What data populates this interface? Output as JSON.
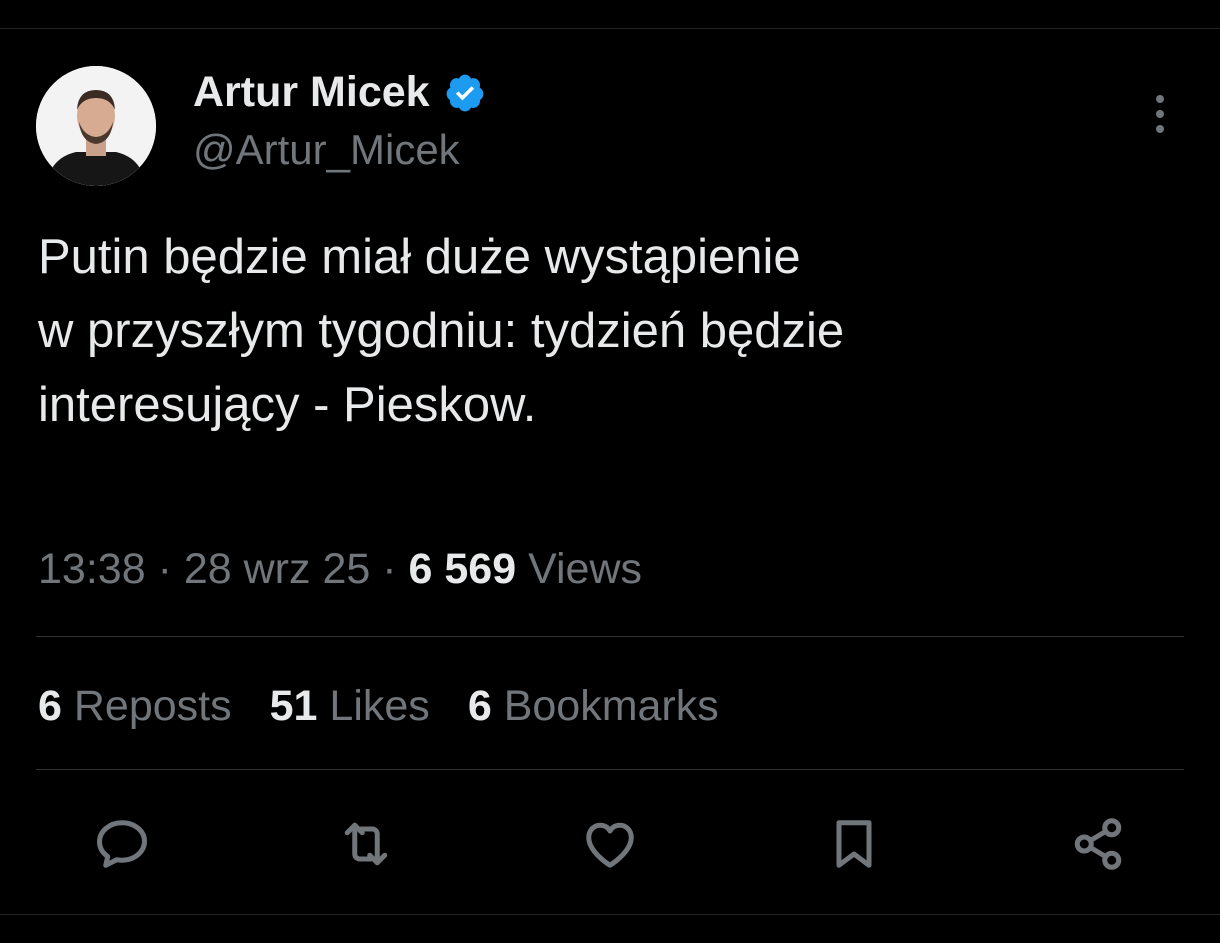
{
  "tweet": {
    "author": {
      "name": "Artur Micek",
      "handle": "@Artur_Micek",
      "verified": true,
      "verified_color": "#1d9bf0",
      "avatar_icon": "profile-photo"
    },
    "more_icon": "more-vertical-icon",
    "text_lines": [
      "Putin będzie miał duże wystąpienie",
      "w przyszłym tygodniu: tydzień będzie",
      "interesujący - Pieskow."
    ],
    "meta": {
      "time": "13:38",
      "date": "28 wrz 25",
      "separator": "·",
      "views_count": "6 569",
      "views_label": "Views"
    },
    "stats": {
      "reposts": {
        "count": "6",
        "label": "Reposts"
      },
      "likes": {
        "count": "51",
        "label": "Likes"
      },
      "bookmarks": {
        "count": "6",
        "label": "Bookmarks"
      }
    },
    "actions": [
      {
        "name": "reply",
        "icon": "reply-icon"
      },
      {
        "name": "repost",
        "icon": "repost-icon"
      },
      {
        "name": "like",
        "icon": "heart-icon"
      },
      {
        "name": "bookmark",
        "icon": "bookmark-icon"
      },
      {
        "name": "share",
        "icon": "share-icon"
      }
    ]
  },
  "colors": {
    "background": "#000000",
    "text_primary": "#e7e9ea",
    "text_secondary": "#71767b",
    "divider": "#2f3336"
  }
}
